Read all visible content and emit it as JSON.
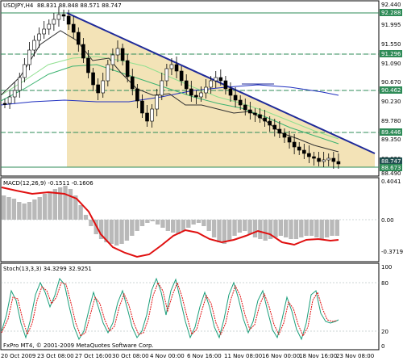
{
  "window": {
    "symbol_caption": "USDJPY,H4",
    "ohlc": "88.831 88.848 88.571 88.747"
  },
  "main_panel": {
    "price_ticks": [
      "92.440",
      "91.995",
      "91.550",
      "91.090",
      "90.670",
      "90.230",
      "89.780",
      "89.350",
      "88.920",
      "88.490"
    ],
    "badges": [
      {
        "text": "92.288",
        "bg": "#2e8b57"
      },
      {
        "text": "91.296",
        "bg": "#2e8b57"
      },
      {
        "text": "90.462",
        "bg": "#2e8b57"
      },
      {
        "text": "89.446",
        "bg": "#2e8b57"
      },
      {
        "text": "88.747",
        "bg": "#1f4f4f"
      },
      {
        "text": "88.673",
        "bg": "#2e8b57"
      }
    ]
  },
  "macd_panel": {
    "caption": "MACD(12,26,9) -0.1511 -0.1606",
    "ticks": [
      "0.4041",
      "0.00",
      "-0.3719"
    ]
  },
  "stoch_panel": {
    "caption": "Stoch(13,3,3) 34.3299 32.9251",
    "ticks": [
      "100",
      "80",
      "20",
      "0"
    ],
    "copyright": "FxPro MT4, © 2001-2009 MetaQuotes Software Corp."
  },
  "time_axis": [
    "20 Oct 2009",
    "23 Oct 08:00",
    "27 Oct 16:00",
    "30 Oct 08:00",
    "4 Nov 00:00",
    "6 Nov 16:00",
    "11 Nov 08:00",
    "16 Nov 00:00",
    "18 Nov 16:00",
    "23 Nov 08:00"
  ],
  "colors": {
    "triangle_fill": "#f3e3b7",
    "trendline": "#1f2a99",
    "hline": "#2e8b57",
    "macd_signal": "#e01010",
    "macd_hist": "#b9b9b9",
    "stoch_main": "#1a9e7a",
    "stoch_signal": "#e01010",
    "candle": "#000000"
  }
}
